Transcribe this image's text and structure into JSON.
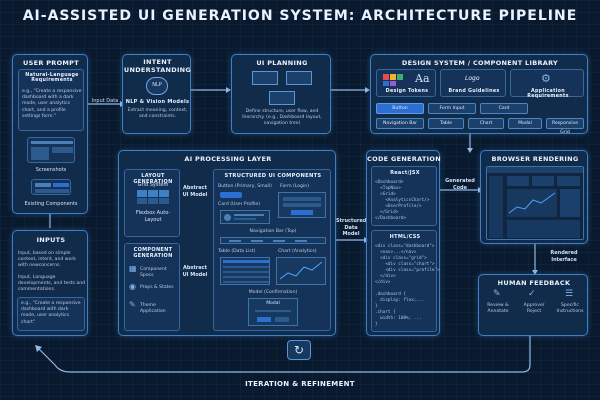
{
  "title": "AI-ASSISTED UI GENERATION SYSTEM: ARCHITECTURE PIPELINE",
  "user_prompt": {
    "title": "USER PROMPT",
    "nl_title": "Natural-Language Requirements",
    "nl_example": "e.g., \"Create a responsive dashboard with a dark mode, user analytics chart, and a profile settings form.\"",
    "screenshots": "Screenshots",
    "existing_components": "Existing Components"
  },
  "input_data_label": "Input Data",
  "intent": {
    "title": "INTENT UNDERSTANDING",
    "nlp_badge": "NLP",
    "models": "NLP & Vision Models",
    "desc": "Extract meaning, context, and constraints."
  },
  "planning": {
    "title": "UI PLANNING",
    "desc": "Define structure, user flow, and hierarchy. (e.g., Dashboard layout, navigation tree)"
  },
  "design_system": {
    "title": "DESIGN SYSTEM / COMPONENT LIBRARY",
    "tokens": "Design Tokens",
    "guidelines": "Brand Guidelines",
    "logo": "Logo",
    "requirements": "Application Requirements",
    "components": [
      "Button",
      "Form Input",
      "Card",
      "Navigation Bar",
      "Table",
      "Chart",
      "Modal",
      "Responsive Grid"
    ]
  },
  "ai_layer": {
    "title": "AI PROCESSING LAYER",
    "layout_title": "LAYOUT GENERATION",
    "grid": "Grid System",
    "flexbox": "Flexbox Auto-Layout",
    "abstract_ui_1": "Abstract UI Model",
    "component_title": "COMPONENT GENERATION",
    "specs": "Component Specs",
    "props": "Props & States",
    "theme": "Theme Application",
    "abstract_ui_2": "Abstract UI Model",
    "structured_title": "STRUCTURED UI COMPONENTS",
    "button_label": "Button (Primary, Small)",
    "form_label": "Form (Login)",
    "card_label": "Card (User Profile)",
    "nav_label": "Navigation Bar (Top)",
    "table_label": "Table (Data List)",
    "chart_label": "Chart (Analytics)",
    "modal_label": "Model (Confirmation)",
    "modal_head": "Modal"
  },
  "structured_model_label": "Structured Data Model",
  "codegen": {
    "title": "CODE GENERATION",
    "react_title": "React/JSX",
    "react_code": "<Dashboard>\n  <TopNav>\n  <Grid>\n    <AnalyticsChart/>\n    <UserProfile/>\n  </Grid>\n</Dashboard>",
    "html_title": "HTML/CSS",
    "html_code": "<div class=\"dashboard\">\n  <nav>...</nav>\n  <div class=\"grid\">\n    <div class=\"chart\">\n    <div class=\"profile\">\n  </div>\n</div>\n\n.dashboard {\n  display: flex;...\n}\n.chart {\n  width: 100%; ...\n}"
  },
  "generated_code_label": "Generated Code",
  "browser": {
    "title": "BROWSER RENDERING"
  },
  "rendered_label": "Rendered Interface",
  "feedback": {
    "title": "HUMAN FEEDBACK",
    "review": "Review & Annotate",
    "approve": "Approve/ Reject",
    "specific": "Specific Instructions"
  },
  "inputs": {
    "title": "INPUTS",
    "p1": "Input, based on simple context, intent, and work with newconcerns.",
    "p2": "Input, Language developments, and tests and commentations.",
    "example": "e.g., \"Create a responsive dashboard with dark mode, user analytics chart\""
  },
  "loop_label": "ITERATION & REFINEMENT",
  "colors": {
    "accent": "#3f7fc4",
    "primary": "#2d6fd0",
    "bg": "#0a1a2e",
    "chart_line": "#4fa3ff"
  }
}
